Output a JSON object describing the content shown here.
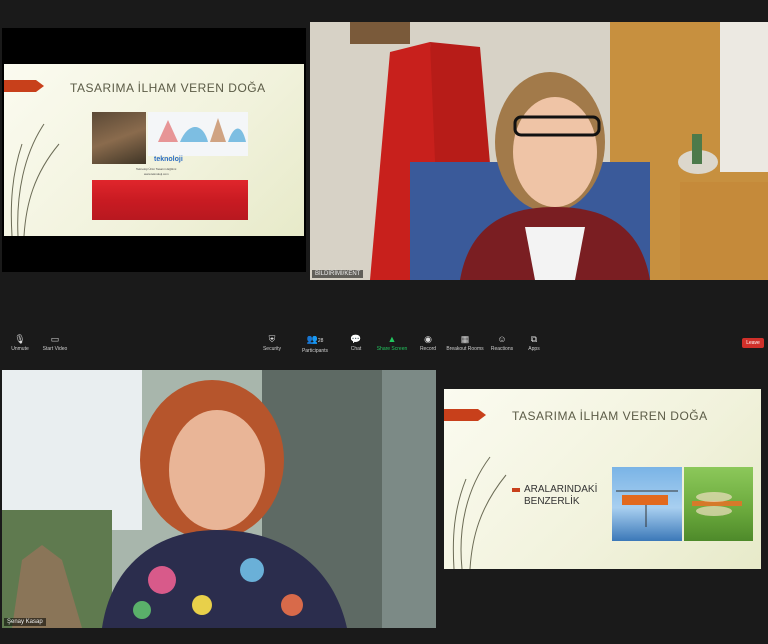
{
  "slide1": {
    "title": "TASARIMA İLHAM VEREN DOĞA",
    "logo_text": "teknoloji",
    "logo_sub": "Teknoloji Ürün Tasarım Eğitimi",
    "logo_url": "www.teknoloji.com"
  },
  "cam1": {
    "name": "BİLDİRİMİ/KENT"
  },
  "toolbar": {
    "unmute": "Unmute",
    "start_video": "Start Video",
    "security": "Security",
    "participants": "Participants",
    "participants_count": "28",
    "chat": "Chat",
    "share_screen": "Share Screen",
    "record": "Record",
    "breakout": "Breakout Rooms",
    "reactions": "Reactions",
    "apps": "Apps",
    "leave": "Leave"
  },
  "cam2": {
    "name": "Şenay Kasap"
  },
  "slide2": {
    "title": "TASARIMA İLHAM VEREN DOĞA",
    "bullet": "ARALARINDAKİ BENZERLİK"
  },
  "colors": {
    "accent_red": "#c8401b",
    "share_green": "#22c55e",
    "leave_red": "#d0302a"
  }
}
